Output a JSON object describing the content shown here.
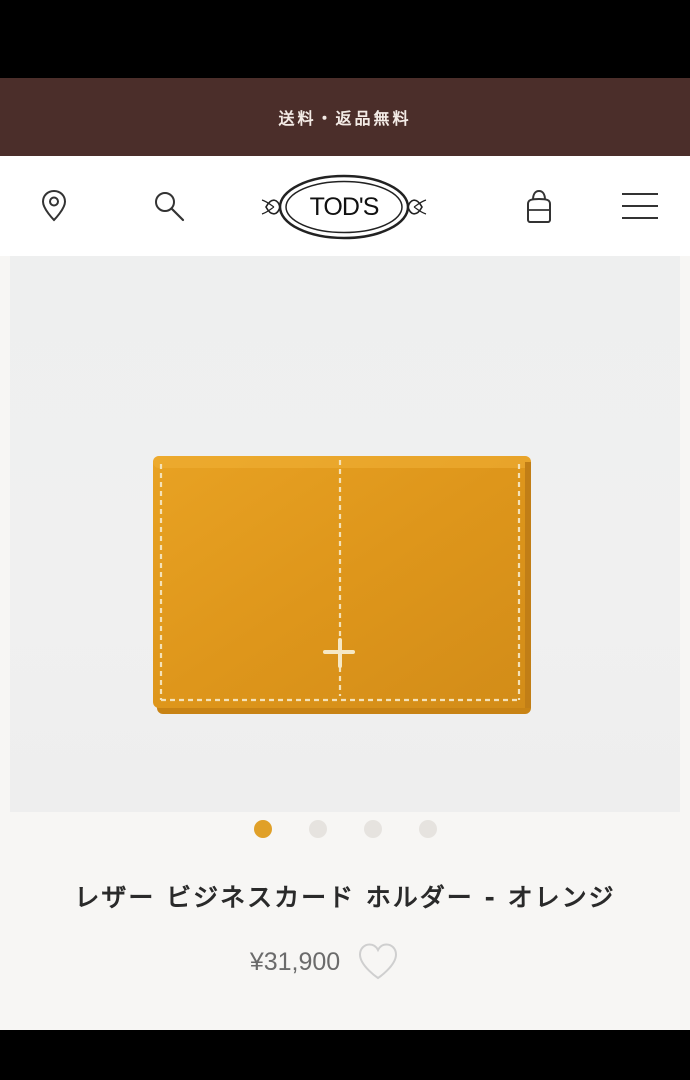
{
  "promo": {
    "text": "送料・返品無料"
  },
  "header": {
    "logo_text": "TOD'S",
    "icons": [
      "location-pin-icon",
      "search-icon",
      "shopping-bag-icon",
      "hamburger-menu-icon"
    ]
  },
  "carousel": {
    "total_slides": 4,
    "active_index": 0
  },
  "product": {
    "title": "レザー ビジネスカード ホルダー - オレンジ",
    "price": "¥31,900",
    "color": "#e29a1f"
  },
  "colors": {
    "promo_bg": "#4b2e2a",
    "dot_active": "#e0a028",
    "dot_inactive": "#e6e3df"
  }
}
